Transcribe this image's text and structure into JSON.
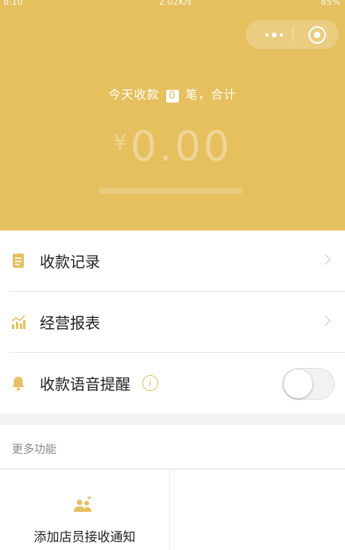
{
  "status_bar": {
    "time": "8:10",
    "speed": "2.02K/s",
    "battery": "85%"
  },
  "header": {
    "today_prefix": "今天收款",
    "count": "0",
    "today_suffix": "笔，合计",
    "currency": "¥",
    "amount": "0.00",
    "accent": "#e6bf5e"
  },
  "menu": {
    "items": [
      {
        "label": "收款记录",
        "icon": "receipt-icon"
      },
      {
        "label": "经营报表",
        "icon": "report-chart-icon"
      },
      {
        "label": "收款语音提醒",
        "icon": "bell-icon",
        "toggle_on": false
      }
    ],
    "info_glyph": "i"
  },
  "more": {
    "title": "更多功能",
    "items": [
      {
        "label": "添加店员接收通知",
        "icon": "add-staff-icon"
      }
    ]
  }
}
